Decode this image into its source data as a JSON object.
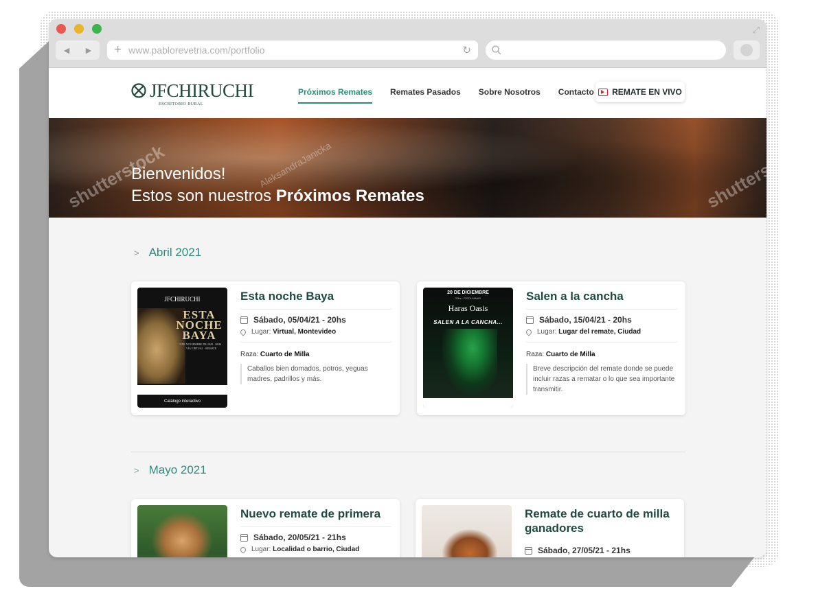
{
  "browser": {
    "url": "www.pablorevetria.com/portfolio",
    "traffic_colors": [
      "#e8584f",
      "#e8b52a",
      "#39b54a"
    ]
  },
  "site": {
    "logo_name": "JFCHIRUCHI",
    "logo_sub": "ESCRITORIO RURAL",
    "menu": [
      "Próximos Remates",
      "Remates Pasados",
      "Sobre Nosotros",
      "Contacto"
    ],
    "live_label": "REMATE EN VIVO",
    "accent": "#2d8b7c"
  },
  "hero": {
    "line1": "Bienvenidos!",
    "line2_prefix": "Estos son nuestros ",
    "line2_bold": "Próximos Remates",
    "watermark_1": "shutterstock",
    "watermark_2": "AleksandraJanicka",
    "watermark_3": "shutterstock"
  },
  "sections": [
    {
      "month": "Abril 2021",
      "cards": [
        {
          "title": "Esta noche Baya",
          "date": "Sábado, 05/04/21 - 20hs",
          "place_label": "Lugar: ",
          "place": "Virtual, Montevideo",
          "breed_label": "Raza: ",
          "breed": "Cuarto de Milla",
          "desc": "Caballos bien domados, potros, yeguas madres, padrillos y más.",
          "poster": {
            "brand": "JFCHIRUCHI",
            "big": "ESTA NOCHE BAYA",
            "small": "5 DE NOVIEMBRE DE 2020 · 20HS · VÍA VIRTUAL · REMATE",
            "foot": "Catálogo interactivo"
          }
        },
        {
          "title": "Salen a la cancha",
          "date": "Sábado, 15/04/21 - 20hs",
          "place_label": "Lugar: ",
          "place": "Lugar del remate, Ciudad",
          "breed_label": "Raza: ",
          "breed": "Cuarto de Milla",
          "desc": "Breve descripción del remate donde se puede incluir razas a rematar o lo que sea importante transmitir.",
          "poster": {
            "h1": "20 DE DICIEMBRE",
            "h2": "20hs - PISTA MINAS",
            "h3": "Haras Oasis",
            "h4": "SALEN A LA CANCHA..."
          }
        }
      ]
    },
    {
      "month": "Mayo 2021",
      "cards": [
        {
          "title": "Nuevo remate de primera",
          "date": "Sábado, 20/05/21 - 21hs",
          "place_label": "Lugar: ",
          "place": "Localidad o barrio, Ciudad"
        },
        {
          "title": "Remate de cuarto de milla ganadores",
          "date": "Sábado, 27/05/21 - 21hs"
        }
      ]
    }
  ]
}
